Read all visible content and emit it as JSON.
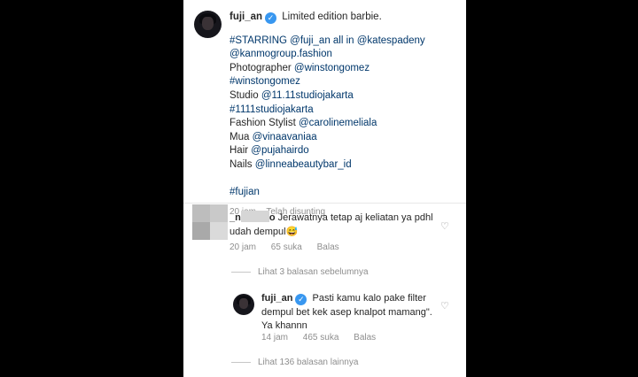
{
  "post": {
    "username": "fuji_an",
    "title": "Limited edition barbie.",
    "caption_lines": [
      "#STARRING @fuji_an all in @katespadeny",
      "@kanmogroup.fashion",
      "Photographer @winstongomez",
      "#winstongomez",
      "Studio @11.11studiojakarta",
      "#1111studiojakarta",
      "Fashion Stylist @carolinemeliala",
      "Mua @vinaavaniaa",
      "Hair @pujahairdo",
      "Nails @linneabeautybar_id",
      "",
      "#fujian"
    ],
    "time": "20 jam",
    "edited": "Telah disunting"
  },
  "comment": {
    "username": "_n",
    "username_suffix": "o",
    "text": "Jerawatnya tetap aj keliatan ya pdhl udah dempul😅",
    "time": "20 jam",
    "likes": "65 suka",
    "reply_label": "Balas"
  },
  "view_previous": "Lihat 3 balasan sebelumnya",
  "reply": {
    "username": "fuji_an",
    "text": "Pasti kamu kalo pake filter dempul bet kek asep knalpot mamang\". Ya khannn",
    "time": "14 jam",
    "likes": "465 suka",
    "reply_label": "Balas"
  },
  "view_more": "Lihat 136 balasan lainnya",
  "icons": {
    "verified": "verified-badge-icon",
    "like": "heart-icon"
  },
  "colors": {
    "verified": "#3897f0",
    "hashtag": "#00376b",
    "meta": "#8e8e8e"
  }
}
